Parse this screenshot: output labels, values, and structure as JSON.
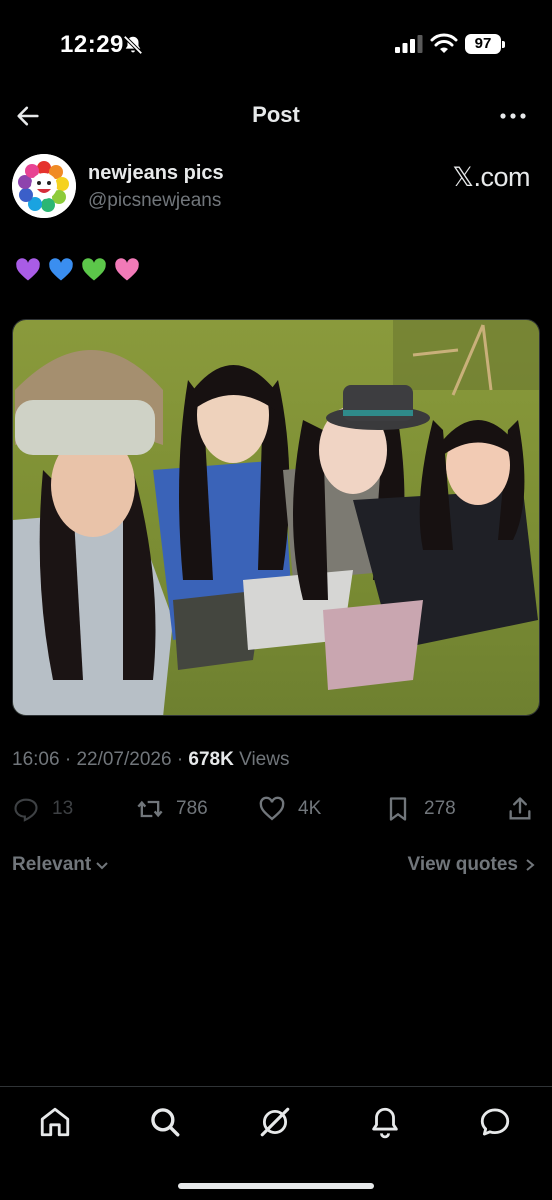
{
  "status_bar": {
    "time": "12:29",
    "battery": "97",
    "icons": [
      "bell-slash-icon",
      "cellular-signal-icon",
      "wifi-icon",
      "battery-icon"
    ]
  },
  "header": {
    "title": "Post",
    "back_icon": "arrow-left-icon",
    "more_icon": "more-horizontal-icon"
  },
  "author": {
    "display_name": "newjeans pics",
    "handle": "@picsnewjeans",
    "source_label": "𝕏.com"
  },
  "tweet": {
    "text": "💜💙💚🩷",
    "emojis": [
      {
        "name": "purple-heart",
        "color": "#a95ce6"
      },
      {
        "name": "blue-heart",
        "color": "#3a8ef0"
      },
      {
        "name": "green-heart",
        "color": "#5cc74a"
      },
      {
        "name": "pink-heart",
        "color": "#f27ab8"
      }
    ]
  },
  "meta": {
    "time": "16:06",
    "date": "22/07/2026",
    "separator": "·",
    "views_count": "678K",
    "views_label": "Views"
  },
  "actions": {
    "replies": "13",
    "reposts": "786",
    "likes": "4K",
    "bookmarks": "278"
  },
  "filters": {
    "sort_label": "Relevant",
    "view_quotes_label": "View quotes"
  },
  "bottom_nav": {
    "items": [
      "home-icon",
      "search-icon",
      "grok-icon",
      "notifications-bell-icon",
      "messages-icon"
    ]
  },
  "colors": {
    "background": "#000000",
    "text_primary": "#e7e9ea",
    "text_secondary": "#71767b",
    "divider": "#2f3336"
  }
}
